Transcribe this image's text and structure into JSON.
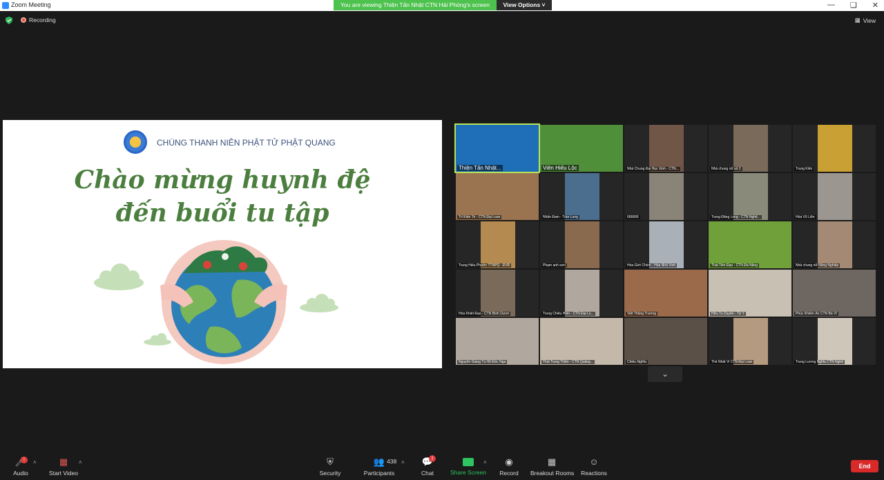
{
  "window": {
    "title": "Zoom Meeting",
    "viewing_banner": "You are viewing Thiện Tấn Nhật CTN Hải Phòng's screen",
    "view_options": "View Options",
    "controls": [
      "minimize",
      "maximize",
      "close"
    ]
  },
  "meeting": {
    "recording_label": "Recording",
    "view_label": "View"
  },
  "shared_screen": {
    "organization": "CHÚNG THANH NIÊN PHẬT TỬ PHẬT QUANG",
    "title_line1": "Chào mừng huynh đệ",
    "title_line2": "đến buổi tu tập"
  },
  "participants": [
    {
      "name": "Thiện Tấn Nhật...",
      "color": "#1e6fb8"
    },
    {
      "name": "Viên Hiếu Lộc",
      "color": "#4f8f3a"
    },
    {
      "name": "Nhà Chung Đại Học Vinh - CTN...",
      "color": "#6f5646"
    },
    {
      "name": "Nhà chung nữ số 2",
      "color": "#7a6a5a"
    },
    {
      "name": "Trung Kiên",
      "color": "#c9a033"
    },
    {
      "name": "Trí Kiến Tri - CTN Đại Loan",
      "color": "#9a7450"
    },
    {
      "name": "Nhân Đam - Trần Lung",
      "color": "#4b6d8e"
    },
    {
      "name": "666666",
      "color": "#8a8478"
    },
    {
      "name": "Trung Đăng Long - CTN Nghệ...",
      "color": "#8a8a7a"
    },
    {
      "name": "Hòa Vũ Liên",
      "color": "#9c9690"
    },
    {
      "name": "Trung Hiếu Phước TTNPQ - ĐVĐ",
      "color": "#b48a50"
    },
    {
      "name": "Phạm anh sơn",
      "color": "#8a6a4e"
    },
    {
      "name": "Hòa Giới Chính - Hòa Nhã Vinh",
      "color": "#aab0b8"
    },
    {
      "name": "Thái Tiến Đạo - CTN Đà Nẵng",
      "color": "#6fa03a"
    },
    {
      "name": "Nhà chung nữ Nông Nghiệp",
      "color": "#a48a74"
    },
    {
      "name": "Hòa Khiết Đạo - CTN Bình Dươn",
      "color": "#7a6a5a"
    },
    {
      "name": "Trung Chiếu Hiền - CTN Đại Lo...",
      "color": "#b0a89e"
    },
    {
      "name": "Việt Thắng Trương",
      "color": "#9a6a4a"
    },
    {
      "name": "Hữu Tu Duyên - Tứ Y",
      "color": "#c9c0b4"
    },
    {
      "name": "Phúc Khiêm Ân CTN Bà Vĩ",
      "color": "#6e6660"
    },
    {
      "name": "Nguyễn Giang Tú Hộ Đức Nga",
      "color": "#b0a89e"
    },
    {
      "name": "Thái Trung Thiện - CTN Quảng...",
      "color": "#c4b8aa"
    },
    {
      "name": "Chiêu Nghĩa",
      "color": "#5a5048"
    },
    {
      "name": "Thế Nhất Vi CTN Đại Loan",
      "color": "#b49a7e"
    },
    {
      "name": "Trung Lương Nghĩa CTN Nghệ",
      "color": "#cfc6ba"
    }
  ],
  "toolbar": {
    "audio": {
      "label": "Audio",
      "badge": "!"
    },
    "video": {
      "label": "Start Video"
    },
    "security": {
      "label": "Security"
    },
    "participants": {
      "label": "Participants",
      "count": "438"
    },
    "chat": {
      "label": "Chat",
      "badge": "1"
    },
    "share": {
      "label": "Share Screen",
      "color": "#2ec462"
    },
    "record": {
      "label": "Record"
    },
    "breakout": {
      "label": "Breakout Rooms"
    },
    "reactions": {
      "label": "Reactions"
    },
    "end": {
      "label": "End",
      "color": "#d92929"
    }
  }
}
